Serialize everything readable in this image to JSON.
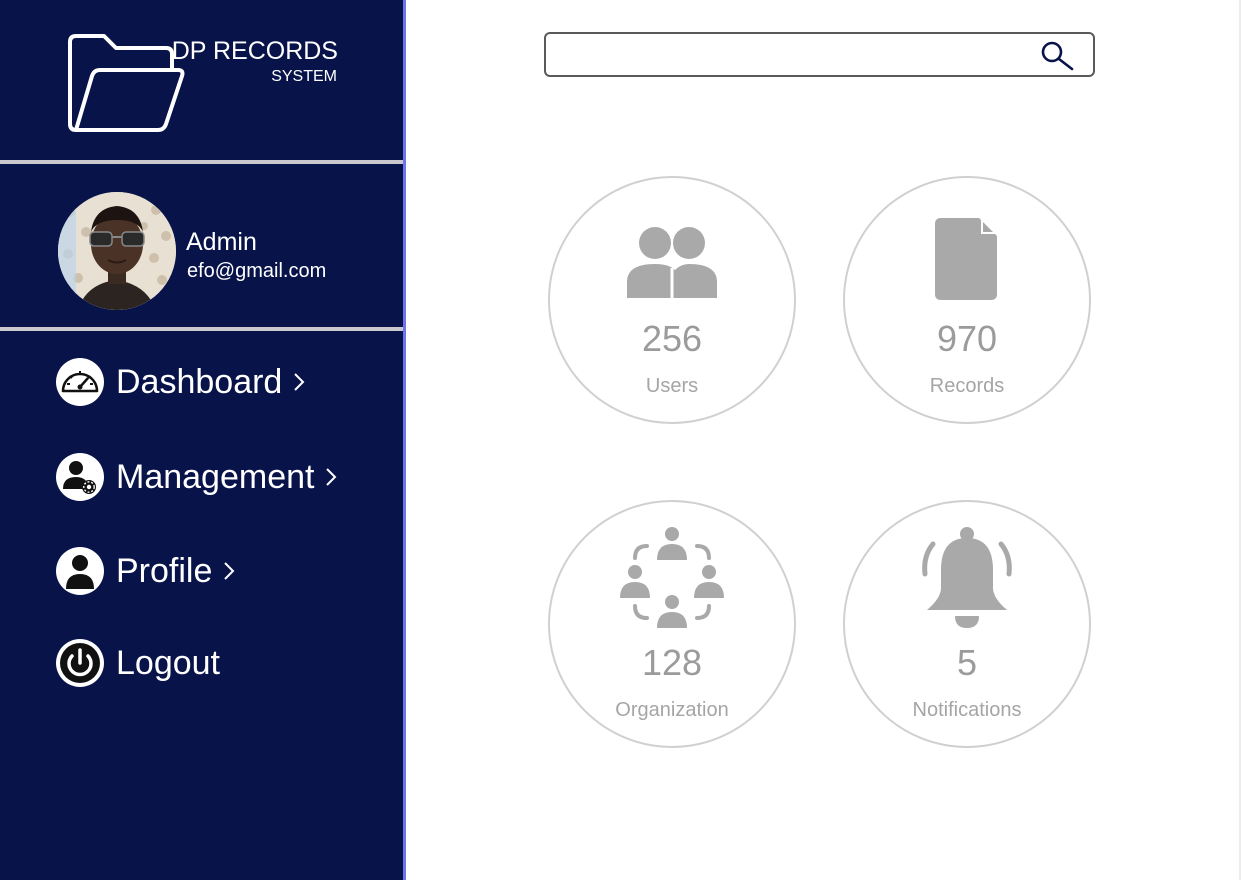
{
  "brand": {
    "title": "DP RECORDS",
    "subtitle": "SYSTEM",
    "logo_icon": "folder-icon"
  },
  "user": {
    "name": "Admin",
    "email": "efo@gmail.com"
  },
  "nav": [
    {
      "label": "Dashboard",
      "icon": "speedometer-icon",
      "has_chevron": true
    },
    {
      "label": "Management",
      "icon": "user-gear-icon",
      "has_chevron": true
    },
    {
      "label": "Profile",
      "icon": "user-icon",
      "has_chevron": true
    },
    {
      "label": "Logout",
      "icon": "power-icon",
      "has_chevron": false
    }
  ],
  "search": {
    "value": "",
    "placeholder": ""
  },
  "stats": [
    {
      "value": "256",
      "label": "Users",
      "icon": "users-icon"
    },
    {
      "value": "970",
      "label": "Records",
      "icon": "document-icon"
    },
    {
      "value": "128",
      "label": "Organization",
      "icon": "organization-icon"
    },
    {
      "value": "5",
      "label": "Notifications",
      "icon": "bell-icon"
    }
  ],
  "colors": {
    "sidebar_bg": "#08134a",
    "sidebar_edge": "#6f74e6",
    "divider": "#c9c9cf",
    "stat_icon": "#a9a9a9",
    "stat_border": "#d0d0d0",
    "search_icon": "#08134a"
  }
}
